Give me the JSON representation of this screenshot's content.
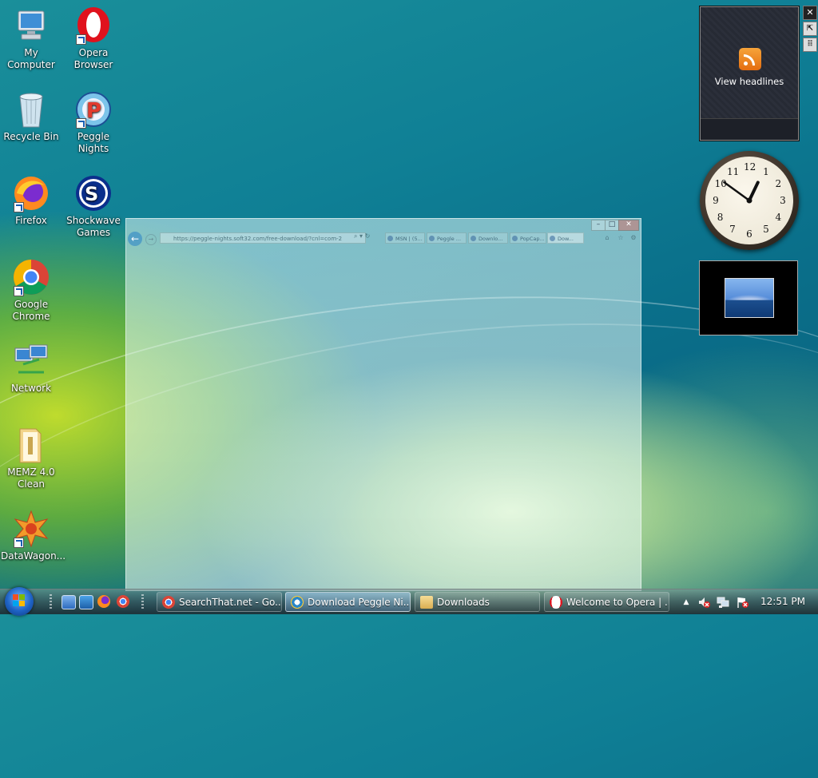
{
  "desktop": {
    "icons": [
      {
        "label": "My Computer",
        "icon": "computer-icon"
      },
      {
        "label": "Opera Browser",
        "icon": "opera-icon"
      },
      {
        "label": "Recycle Bin",
        "icon": "recycle-bin-icon"
      },
      {
        "label": "Peggle Nights",
        "icon": "peggle-icon"
      },
      {
        "label": "Firefox",
        "icon": "firefox-icon"
      },
      {
        "label": "Shockwave Games",
        "icon": "shockwave-icon"
      },
      {
        "label": "Google Chrome",
        "icon": "chrome-icon"
      },
      {
        "label": "Network",
        "icon": "network-icon"
      },
      {
        "label": "MEMZ 4.0 Clean",
        "icon": "folder-icon"
      },
      {
        "label": "DataWagon...",
        "icon": "datawagon-icon"
      }
    ]
  },
  "browser": {
    "address": "https://peggle-nights.soft32.com/free-download/?cnl=com-2",
    "tabs": [
      {
        "label": "MSN | (5..."
      },
      {
        "label": "Peggle ..."
      },
      {
        "label": "Downlo..."
      },
      {
        "label": "PopCap..."
      },
      {
        "label": "Dow..."
      }
    ],
    "colors": {
      "accent": "#2a86c8"
    }
  },
  "gadgets": {
    "feed": {
      "label": "View headlines",
      "icon": "rss-icon"
    },
    "clock": {
      "hour": 12,
      "minute": 51,
      "numbers": [
        "12",
        "1",
        "2",
        "3",
        "4",
        "5",
        "6",
        "7",
        "8",
        "9",
        "10",
        "11"
      ]
    },
    "slideshow": {
      "icon": "photo-icon"
    },
    "controls": {
      "close": "✕",
      "dock": "⇱",
      "drag": "⠿"
    }
  },
  "taskbar": {
    "tasks": [
      {
        "label": "SearchThat.net - Go...",
        "icon": "chrome-icon",
        "active": false
      },
      {
        "label": "Download Peggle Ni...",
        "icon": "ie-icon",
        "active": true
      },
      {
        "label": "Downloads",
        "icon": "folder-icon",
        "active": false
      },
      {
        "label": "Welcome to Opera | ...",
        "icon": "opera-icon",
        "active": false
      }
    ],
    "tray": {
      "show_hidden": "▲",
      "volume_icon": "volume-muted-icon",
      "network_icon": "network-icon",
      "flag_icon": "action-center-icon",
      "time": "12:51 PM"
    }
  }
}
